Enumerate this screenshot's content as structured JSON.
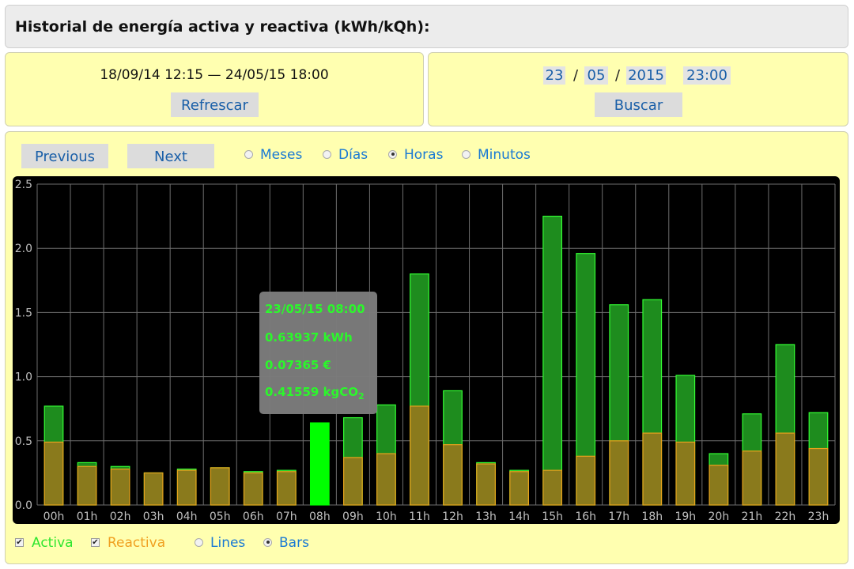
{
  "header": {
    "title": "Historial de energía activa y reactiva (kWh/kQh):"
  },
  "range": {
    "text": "18/09/14 12:15 — 24/05/15 18:00",
    "refresh_label": "Refrescar"
  },
  "search": {
    "day": "23",
    "month": "05",
    "year": "2015",
    "time": "23:00",
    "sep": "/",
    "search_label": "Buscar"
  },
  "nav": {
    "previous_label": "Previous",
    "next_label": "Next"
  },
  "granularity": {
    "options": [
      {
        "label": "Meses",
        "selected": false
      },
      {
        "label": "Días",
        "selected": false
      },
      {
        "label": "Horas",
        "selected": true
      },
      {
        "label": "Minutos",
        "selected": false
      }
    ]
  },
  "tooltip": {
    "line1": "23/05/15 08:00",
    "line2": "0.63937 kWh",
    "line3": "0.07365 €",
    "line4_prefix": "0.41559 kgCO",
    "line4_sub": "2"
  },
  "legend": {
    "activa_label": "Activa",
    "activa_checked": true,
    "reactiva_label": "Reactiva",
    "reactiva_checked": true,
    "lines_label": "Lines",
    "lines_selected": false,
    "bars_label": "Bars",
    "bars_selected": true
  },
  "colors": {
    "activa_fill": "#1e8c1e",
    "activa_stroke": "#33ff33",
    "highlight": "#00ff00",
    "reactiva_fill": "#8a7a1c",
    "reactiva_stroke": "#e8a21c",
    "grid": "#6e6e6e",
    "tick_text": "#bfbfbf",
    "panel_bg": "#ffffb0"
  },
  "chart_data": {
    "type": "bar",
    "categories": [
      "00h",
      "01h",
      "02h",
      "03h",
      "04h",
      "05h",
      "06h",
      "07h",
      "08h",
      "09h",
      "10h",
      "11h",
      "12h",
      "13h",
      "14h",
      "15h",
      "16h",
      "17h",
      "18h",
      "19h",
      "20h",
      "21h",
      "22h",
      "23h"
    ],
    "series": [
      {
        "name": "Activa",
        "values": [
          0.77,
          0.33,
          0.3,
          0.25,
          0.28,
          0.29,
          0.26,
          0.27,
          0.64,
          0.68,
          0.78,
          1.8,
          0.89,
          0.33,
          0.27,
          2.25,
          1.96,
          1.56,
          1.6,
          1.01,
          0.4,
          0.71,
          1.25,
          0.72
        ]
      },
      {
        "name": "Reactiva",
        "values": [
          0.49,
          0.3,
          0.28,
          0.25,
          0.27,
          0.29,
          0.25,
          0.26,
          0.0,
          0.37,
          0.4,
          0.77,
          0.47,
          0.32,
          0.26,
          0.27,
          0.38,
          0.5,
          0.56,
          0.49,
          0.31,
          0.42,
          0.56,
          0.44
        ]
      }
    ],
    "highlight_index": 8,
    "ylim": [
      0,
      2.5
    ],
    "yticks": [
      "0.0",
      "0.5",
      "1.0",
      "1.5",
      "2.0",
      "2.5"
    ],
    "ytick_values": [
      0,
      0.5,
      1.0,
      1.5,
      2.0,
      2.5
    ],
    "grid": true
  }
}
